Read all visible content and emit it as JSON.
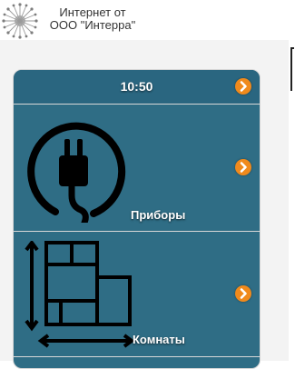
{
  "header": {
    "title_line1": "Интернет от",
    "title_line2": "ООО \"Интерра\""
  },
  "panel": {
    "time": "10:50",
    "items": [
      {
        "label": "Приборы",
        "icon": "power-plug-icon"
      },
      {
        "label": "Комнаты",
        "icon": "floor-plan-icon"
      }
    ]
  },
  "colors": {
    "panel_background": "#2f6d85",
    "accent_arrow": "#f08a1c"
  }
}
